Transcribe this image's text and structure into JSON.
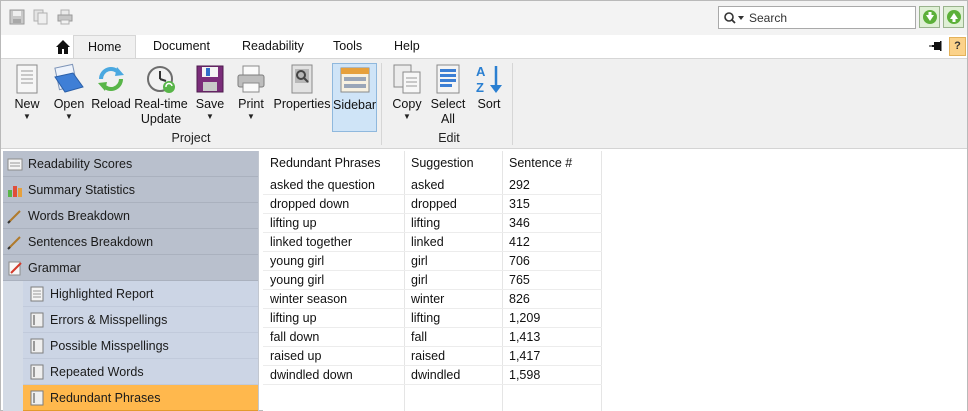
{
  "search": {
    "placeholder": "Search"
  },
  "tabs": [
    "Home",
    "Document",
    "Readability",
    "Tools",
    "Help"
  ],
  "help_badge": "?",
  "ribbon": {
    "project": {
      "label": "Project",
      "buttons": [
        {
          "label": "New",
          "icon": "new-document-icon",
          "dropdown": true
        },
        {
          "label": "Open",
          "icon": "open-folder-icon",
          "dropdown": true
        },
        {
          "label": "Reload",
          "icon": "reload-icon",
          "dropdown": false
        },
        {
          "label": "Real-time",
          "label2": "Update",
          "icon": "realtime-update-icon",
          "dropdown": false
        },
        {
          "label": "Save",
          "icon": "save-icon",
          "dropdown": true
        },
        {
          "label": "Print",
          "icon": "print-icon",
          "dropdown": true
        },
        {
          "label": "Properties",
          "icon": "properties-icon",
          "dropdown": false
        },
        {
          "label": "Sidebar",
          "icon": "sidebar-icon",
          "dropdown": false,
          "pressed": true
        }
      ]
    },
    "edit": {
      "label": "Edit",
      "buttons": [
        {
          "label": "Copy",
          "icon": "copy-icon",
          "dropdown": true
        },
        {
          "label": "Select",
          "label2": "All",
          "icon": "select-all-icon",
          "dropdown": false
        },
        {
          "label": "Sort",
          "icon": "sort-az-icon",
          "dropdown": false
        }
      ]
    }
  },
  "sidebar": {
    "items": [
      {
        "label": "Readability Scores",
        "icon": "readability-scores-icon",
        "level": 0
      },
      {
        "label": "Summary Statistics",
        "icon": "summary-statistics-icon",
        "level": 0
      },
      {
        "label": "Words Breakdown",
        "icon": "words-breakdown-icon",
        "level": 0
      },
      {
        "label": "Sentences Breakdown",
        "icon": "sentences-breakdown-icon",
        "level": 0
      },
      {
        "label": "Grammar",
        "icon": "grammar-icon",
        "level": 0
      },
      {
        "label": "Highlighted Report",
        "icon": "report-page-icon",
        "level": 1
      },
      {
        "label": "Errors & Misspellings",
        "icon": "list-page-icon",
        "level": 1
      },
      {
        "label": "Possible Misspellings",
        "icon": "list-page-icon",
        "level": 1
      },
      {
        "label": "Repeated Words",
        "icon": "list-page-icon",
        "level": 1
      },
      {
        "label": "Redundant Phrases",
        "icon": "list-page-icon",
        "level": 1,
        "selected": true
      }
    ]
  },
  "table": {
    "columns": [
      "Redundant Phrases",
      "Suggestion",
      "Sentence #"
    ],
    "rows": [
      [
        "asked the question",
        "asked",
        "292"
      ],
      [
        "dropped down",
        "dropped",
        "315"
      ],
      [
        "lifting up",
        "lifting",
        "346"
      ],
      [
        "linked together",
        "linked",
        "412"
      ],
      [
        "young girl",
        "girl",
        "706"
      ],
      [
        "young girl",
        "girl",
        "765"
      ],
      [
        "winter season",
        "winter",
        "826"
      ],
      [
        "lifting up",
        "lifting",
        "1,209"
      ],
      [
        "fall down",
        "fall",
        "1,413"
      ],
      [
        "raised up",
        "raised",
        "1,417"
      ],
      [
        "dwindled down",
        "dwindled",
        "1,598"
      ]
    ]
  },
  "colors": {
    "selected_item": "#ffb84d",
    "sidebar_top": "#b9c0cd",
    "sidebar_sub": "#ccd5e5",
    "pressed_button": "#cfe4f7"
  }
}
